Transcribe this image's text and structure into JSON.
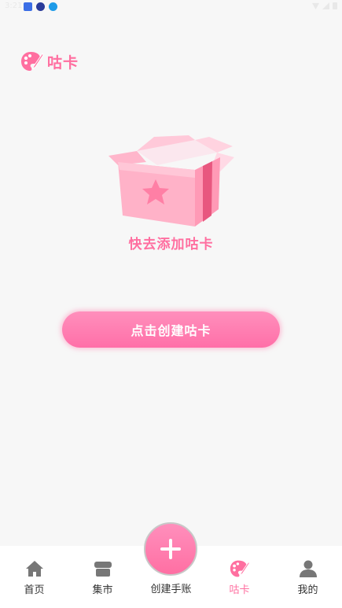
{
  "status_bar": {
    "time": "3:21"
  },
  "header": {
    "title": "咕卡"
  },
  "empty_state": {
    "message": "快去添加咕卡"
  },
  "primary_action": {
    "label": "点击创建咕卡"
  },
  "tabbar": {
    "items": [
      {
        "label": "首页",
        "icon": "home-icon"
      },
      {
        "label": "集市",
        "icon": "shop-icon"
      },
      {
        "label": "创建手账",
        "icon": "plus-icon"
      },
      {
        "label": "咕卡",
        "icon": "palette-icon",
        "active": true
      },
      {
        "label": "我的",
        "icon": "user-icon"
      }
    ]
  },
  "colors": {
    "accent": "#ff6fa0",
    "background": "#f7f7f7",
    "tab_inactive": "#777777"
  }
}
